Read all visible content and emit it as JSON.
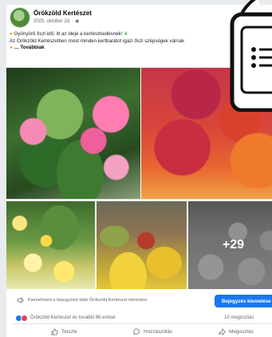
{
  "post": {
    "page_name": "Örökzöld Kertészet",
    "date": "2025. október 28.",
    "text_line_1": "Gyönyörű őszi idő, itt az ideje a kertészkedésnek!",
    "text_line_2": "Az Örökzöld Kertészetben most minden kertbarátot igazi őszi szépségek várnak",
    "see_more": "… Továbbiak"
  },
  "gallery": {
    "more_count": "+29"
  },
  "boost": {
    "text": "Kiemeheted a bejegyzést több Örökzöld Kertészet elérésére.",
    "button_label": "Bejegyzés kiemelése"
  },
  "reactions": {
    "summary": "Örökzöld Kertészet és további 86 ember",
    "shares": "10 megosztás"
  },
  "actions": {
    "like": "Tetszik",
    "comment": "Hozzászólás",
    "share": "Megosztás"
  },
  "colors": {
    "accent": "#1877f2",
    "love": "#f33e58",
    "text_secondary": "#65676b"
  },
  "icons": {
    "boost": "megaphone-icon",
    "like": "thumbs-up-icon",
    "comment": "comment-bubble-icon",
    "share": "share-arrow-icon",
    "overlay": "phone-menu-icon"
  }
}
